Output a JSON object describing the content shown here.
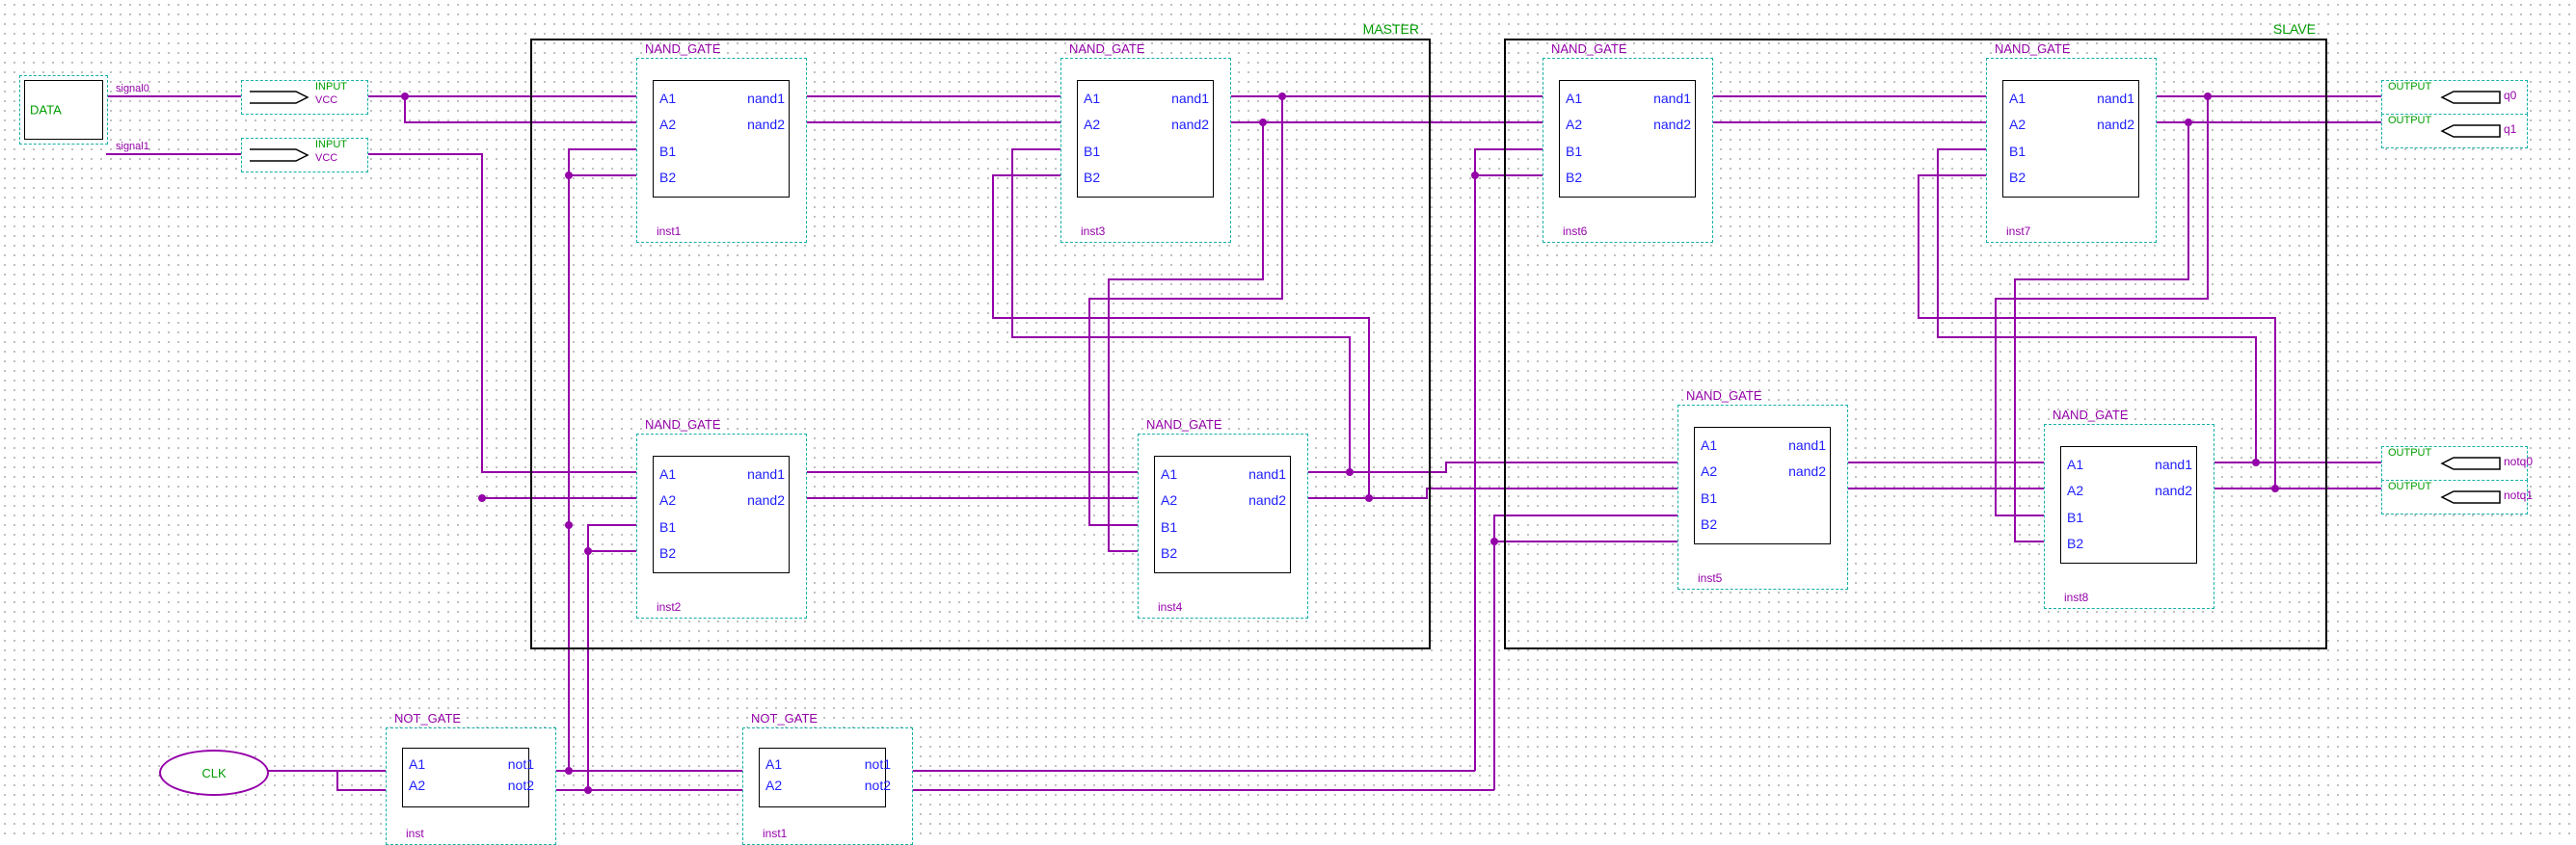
{
  "groups": {
    "master": {
      "label": "MASTER"
    },
    "slave": {
      "label": "SLAVE"
    }
  },
  "gates": {
    "nand_title": "NAND_GATE",
    "not_title": "NOT_GATE",
    "ports": {
      "a1": "A1",
      "a2": "A2",
      "b1": "B1",
      "b2": "B2"
    },
    "outs": {
      "nand1": "nand1",
      "nand2": "nand2",
      "not1": "not1",
      "not2": "not2"
    },
    "inst": {
      "n1": "inst1",
      "n2": "inst2",
      "n3": "inst3",
      "n4": "inst4",
      "n5": "inst5",
      "n6": "inst6",
      "n7": "inst7",
      "n8": "inst8",
      "not0": "inst",
      "not1": "inst1"
    }
  },
  "io": {
    "data_label": "DATA",
    "clk_label": "CLK",
    "input_label": "INPUT",
    "output_label": "OUTPUT",
    "vcc": "VCC",
    "signals": {
      "s0": "signal0",
      "s1": "signal1"
    },
    "q0": "q0",
    "q1": "q1",
    "notq0": "notq0",
    "notq1": "notq1"
  }
}
